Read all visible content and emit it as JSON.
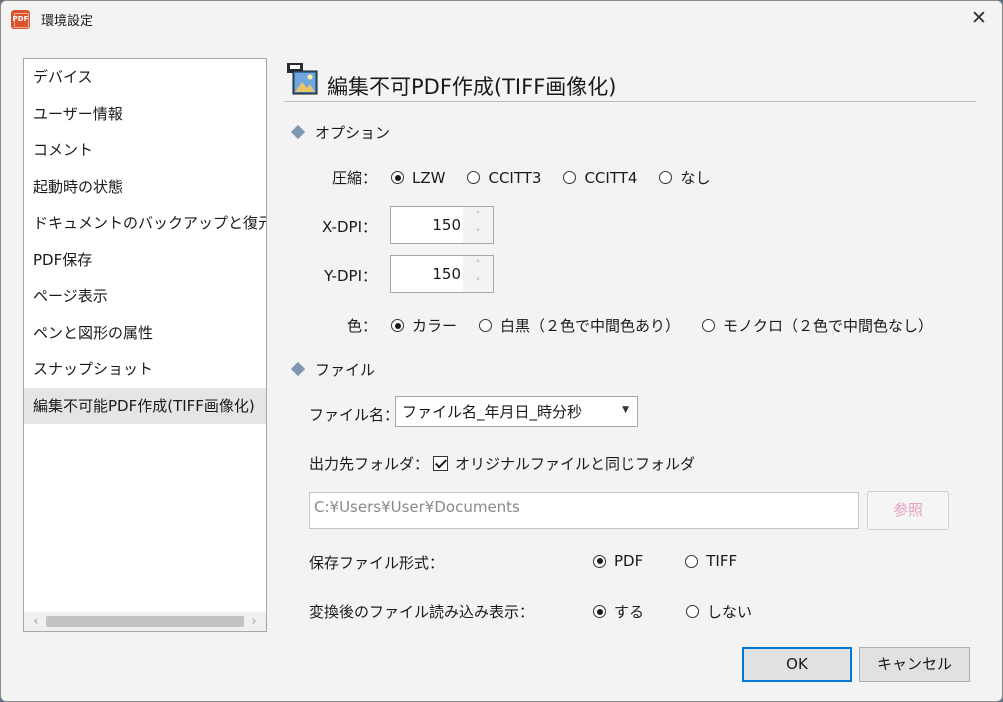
{
  "window": {
    "title": "環境設定",
    "app_icon_text": "PDF"
  },
  "sidebar": {
    "items": [
      {
        "label": "デバイス"
      },
      {
        "label": "ユーザー情報"
      },
      {
        "label": "コメント"
      },
      {
        "label": "起動時の状態"
      },
      {
        "label": "ドキュメントのバックアップと復元"
      },
      {
        "label": "PDF保存"
      },
      {
        "label": "ページ表示"
      },
      {
        "label": "ペンと図形の属性"
      },
      {
        "label": "スナップショット"
      },
      {
        "label": "編集不可能PDF作成(TIFF画像化)"
      }
    ],
    "selected_index": 9
  },
  "panel": {
    "title": "編集不可PDF作成(TIFF画像化)",
    "options_section": "オプション",
    "compression": {
      "label": "圧縮：",
      "options": [
        "LZW",
        "CCITT3",
        "CCITT4",
        "なし"
      ],
      "selected": "LZW"
    },
    "xdpi": {
      "label": "X-DPI：",
      "value": "150"
    },
    "ydpi": {
      "label": "Y-DPI：",
      "value": "150"
    },
    "color": {
      "label": "色：",
      "options": [
        "カラー",
        "白黒（２色で中間色あり）",
        "モノクロ（２色で中間色なし）"
      ],
      "selected": "カラー"
    },
    "file_section": "ファイル",
    "filename": {
      "label": "ファイル名：",
      "value": "ファイル名_年月日_時分秒"
    },
    "output_folder": {
      "label": "出力先フォルダ：",
      "checkbox_label": "オリジナルファイルと同じフォルダ",
      "checked": true
    },
    "path": {
      "placeholder": "C:¥Users¥User¥Documents"
    },
    "browse_label": "参照",
    "save_format": {
      "label": "保存ファイル形式：",
      "options": [
        "PDF",
        "TIFF"
      ],
      "selected": "PDF"
    },
    "load_after": {
      "label": "変換後のファイル読み込み表示：",
      "options": [
        "する",
        "しない"
      ],
      "selected": "する"
    }
  },
  "buttons": {
    "ok": "OK",
    "cancel": "キャンセル"
  },
  "colors": {
    "accent": "#0078d7",
    "browse_text": "#e8a0c0",
    "diamond": "#7f96b0"
  }
}
